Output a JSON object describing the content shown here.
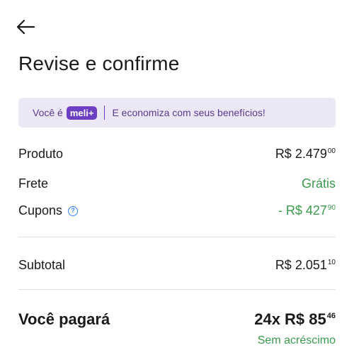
{
  "header": {
    "back_icon": "arrow-left-icon",
    "title": "Revise e confirme"
  },
  "banner": {
    "prefix": "Você é",
    "badge": "meli+",
    "message": "E economiza com seus benefícios!",
    "colors": {
      "background": "#ece7f5",
      "text": "#5a3a8c",
      "badge": "#6c3fc5"
    }
  },
  "summary": {
    "product": {
      "label": "Produto",
      "value": "R$ 2.479",
      "cents": "00"
    },
    "shipping": {
      "label": "Frete",
      "value": "Grátis"
    },
    "coupons": {
      "label": "Cupons",
      "help_icon": "question-circle-icon",
      "value": "- R$ 427",
      "cents": "90"
    },
    "subtotal": {
      "label": "Subtotal",
      "value": "R$ 2.051",
      "cents": "10"
    },
    "total": {
      "label": "Você pagará",
      "value": "24x R$ 85",
      "cents": "46",
      "note": "Sem acréscimo"
    }
  },
  "colors": {
    "positive": "#3a9a4e",
    "link": "#3483fa"
  }
}
